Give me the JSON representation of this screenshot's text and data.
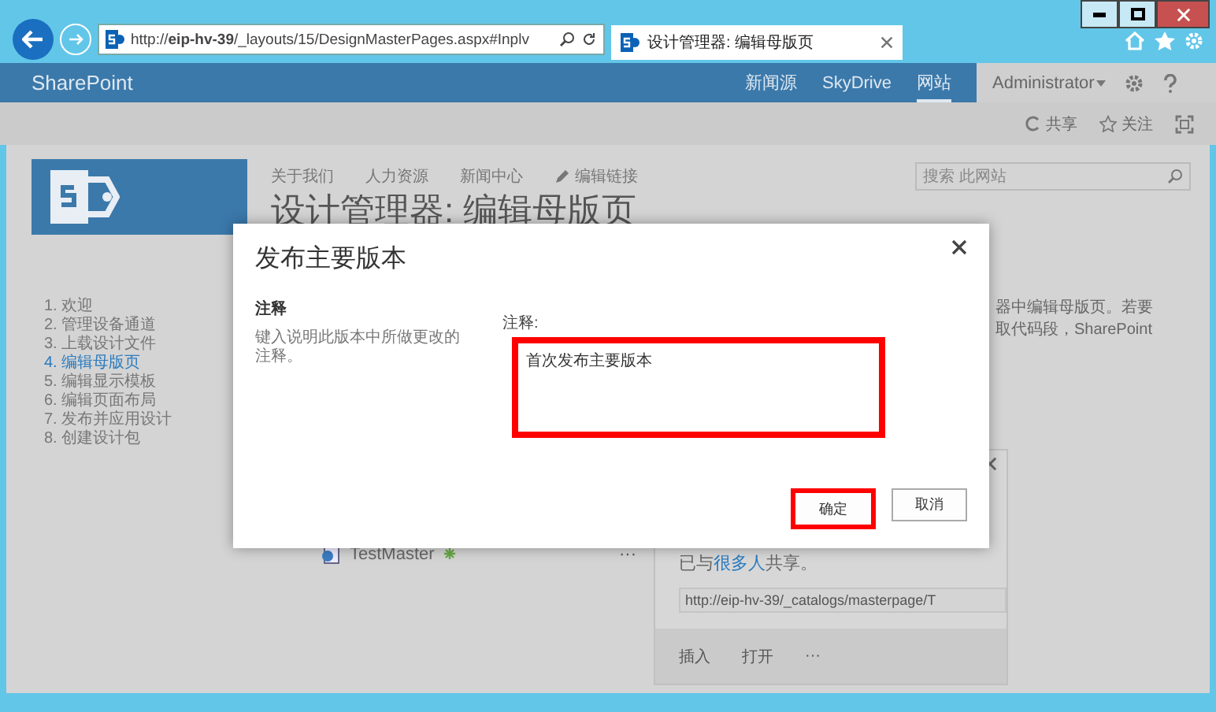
{
  "browser": {
    "address": "http://**eip-hv-39**/_layouts/15/DesignMasterPages.aspx#Inplv",
    "tabs": [
      {
        "title": "设计管理器: 编辑母版页",
        "selected": true
      }
    ]
  },
  "suite_bar": {
    "brand": "SharePoint",
    "links": [
      {
        "label": "新闻源",
        "selected": false
      },
      {
        "label": "SkyDrive",
        "selected": false
      },
      {
        "label": "网站",
        "selected": true
      }
    ],
    "user": "Administrator"
  },
  "ribbon": {
    "actions": [
      {
        "label": "共享",
        "kind": "share"
      },
      {
        "label": "关注",
        "kind": "follow"
      }
    ]
  },
  "site": {
    "nav_links": [
      "关于我们",
      "人力资源",
      "新闻中心"
    ],
    "edit_link": "编辑链接",
    "search": {
      "placeholder": "搜索 此网站"
    },
    "page_title": "设计管理器: 编辑母版页"
  },
  "steps": [
    {
      "label": "1. 欢迎",
      "selected": false
    },
    {
      "label": "2. 管理设备通道",
      "selected": false
    },
    {
      "label": "3. 上载设计文件",
      "selected": false
    },
    {
      "label": "4. 编辑母版页",
      "selected": true
    },
    {
      "label": "5. 编辑显示模板",
      "selected": false
    },
    {
      "label": "6. 编辑页面布局",
      "selected": false
    },
    {
      "label": "7. 发布并应用设计",
      "selected": false
    },
    {
      "label": "8. 创建设计包",
      "selected": false
    }
  ],
  "body_text": [
    "器中编辑母版页。若要",
    "取代码段，SharePoint"
  ],
  "files": [
    {
      "name": "TestMaster",
      "more": "···"
    }
  ],
  "callout": {
    "shared_prefix": "已与",
    "shared_link": "很多人",
    "shared_suffix": "共享。",
    "url": "http://eip-hv-39/_catalogs/masterpage/T",
    "actions": [
      "插入",
      "打开",
      "···"
    ]
  },
  "dialog": {
    "title": "发布主要版本",
    "section_title": "注释",
    "section_description": "键入说明此版本中所做更改的注释。",
    "field_label": "注释:",
    "field_value": "首次发布主要版本",
    "field_highlighted": true,
    "buttons": [
      {
        "label": "确定",
        "highlighted": true
      },
      {
        "label": "取消",
        "highlighted": false
      }
    ]
  }
}
